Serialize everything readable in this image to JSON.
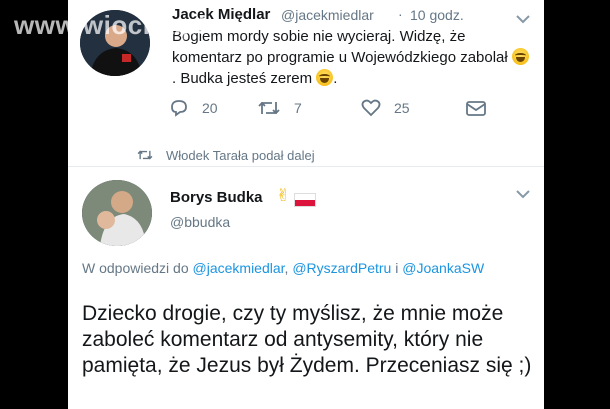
{
  "watermark": "www.wiocha.pl",
  "tweet1": {
    "name": "Jacek Międlar",
    "handle": "@jacekmiedlar",
    "separator": "·",
    "time": "10 godz.",
    "text_line1": "Bogiem mordy sobie nie wycieraj. Widzę, że komentarz po programie u Wojewódzkiego zabolał",
    "text_mid": ". Budka jesteś zerem",
    "reply_count": "20",
    "retweet_count": "7",
    "like_count": "25"
  },
  "retweet_notice": "Włodek Tarała podał dalej",
  "tweet2": {
    "name": "Borys Budka",
    "handle": "@bbudka",
    "reply_prefix": "W odpowiedzi do",
    "mention1": "@jacekmiedlar",
    "comma": ",",
    "mention2": "@RyszardPetru",
    "conj": "i",
    "mention3": "@JoankaSW",
    "text": "Dziecko drogie, czy ty myślisz, że mnie może zaboleć komentarz od antysemity, który nie pamięta, że Jezus był Żydem. Przeceniasz się ;)"
  },
  "colors": {
    "text": "#14171a",
    "muted": "#657786",
    "link": "#1b95e0",
    "divider": "#e6ecf0"
  },
  "icons": [
    "reply-icon",
    "retweet-icon",
    "like-icon",
    "dm-icon",
    "caret-down-icon",
    "victory-hand-icon",
    "poland-flag-icon",
    "grinning-emoji-icon"
  ]
}
